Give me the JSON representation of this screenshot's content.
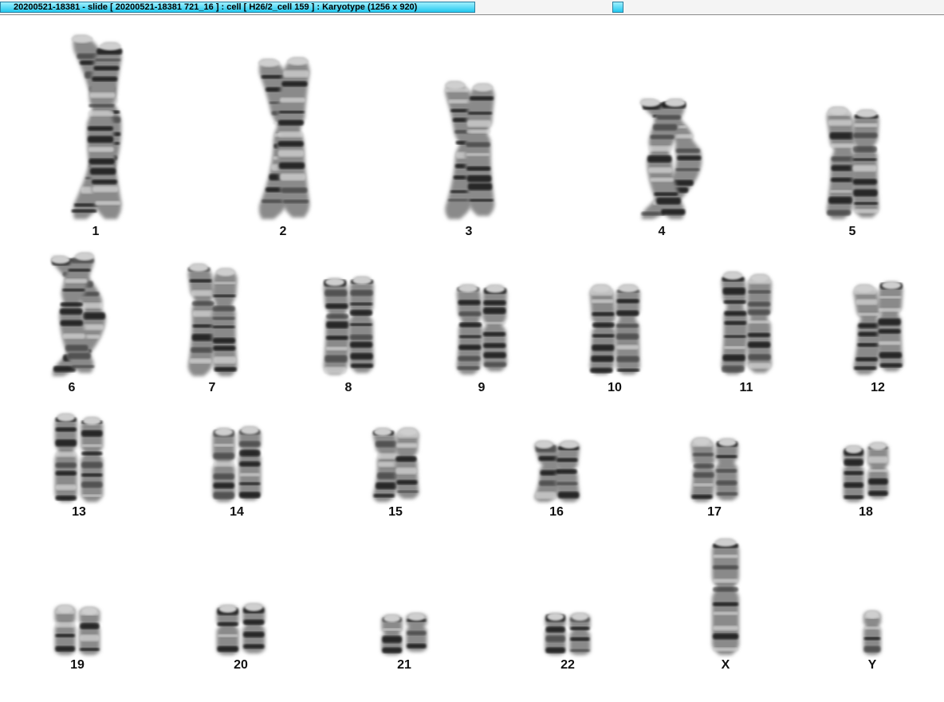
{
  "window": {
    "title": "20200521-18381 - slide [ 20200521-18381 721_16 ] : cell [ H26/2_cell 159 ] : Karyotype  (1256 x 920)"
  },
  "karyotype": {
    "pairs": [
      {
        "label": "1",
        "n": 2,
        "len": 230,
        "width": 34,
        "bend": 0.15
      },
      {
        "label": "2",
        "n": 2,
        "len": 200,
        "width": 34,
        "bend": 0.12
      },
      {
        "label": "3",
        "n": 2,
        "len": 172,
        "width": 32,
        "bend": 0.1
      },
      {
        "label": "4",
        "n": 2,
        "len": 150,
        "width": 32,
        "bend": 0.35
      },
      {
        "label": "5",
        "n": 2,
        "len": 140,
        "width": 32,
        "bend": 0.05
      },
      {
        "label": "6",
        "n": 2,
        "len": 150,
        "width": 30,
        "bend": 0.3
      },
      {
        "label": "7",
        "n": 2,
        "len": 140,
        "width": 30,
        "bend": 0.05
      },
      {
        "label": "8",
        "n": 2,
        "len": 120,
        "width": 30,
        "bend": 0.03
      },
      {
        "label": "9",
        "n": 2,
        "len": 112,
        "width": 30,
        "bend": 0.03
      },
      {
        "label": "10",
        "n": 2,
        "len": 112,
        "width": 30,
        "bend": 0.03
      },
      {
        "label": "11",
        "n": 2,
        "len": 128,
        "width": 30,
        "bend": 0.03
      },
      {
        "label": "12",
        "n": 2,
        "len": 112,
        "width": 30,
        "bend": 0.06
      },
      {
        "label": "13",
        "n": 2,
        "len": 110,
        "width": 28,
        "bend": 0.0
      },
      {
        "label": "14",
        "n": 2,
        "len": 92,
        "width": 28,
        "bend": 0.0
      },
      {
        "label": "15",
        "n": 2,
        "len": 92,
        "width": 28,
        "bend": 0.08
      },
      {
        "label": "16",
        "n": 2,
        "len": 76,
        "width": 28,
        "bend": 0.12
      },
      {
        "label": "17",
        "n": 2,
        "len": 80,
        "width": 28,
        "bend": 0.04
      },
      {
        "label": "18",
        "n": 2,
        "len": 70,
        "width": 26,
        "bend": 0.0
      },
      {
        "label": "19",
        "n": 2,
        "len": 62,
        "width": 26,
        "bend": 0.0
      },
      {
        "label": "20",
        "n": 2,
        "len": 62,
        "width": 28,
        "bend": 0.0
      },
      {
        "label": "21",
        "n": 2,
        "len": 50,
        "width": 26,
        "bend": 0.0
      },
      {
        "label": "22",
        "n": 2,
        "len": 52,
        "width": 26,
        "bend": 0.0
      },
      {
        "label": "X",
        "n": 1,
        "len": 145,
        "width": 34,
        "bend": 0.0
      },
      {
        "label": "Y",
        "n": 1,
        "len": 55,
        "width": 22,
        "bend": 0.0
      }
    ]
  }
}
